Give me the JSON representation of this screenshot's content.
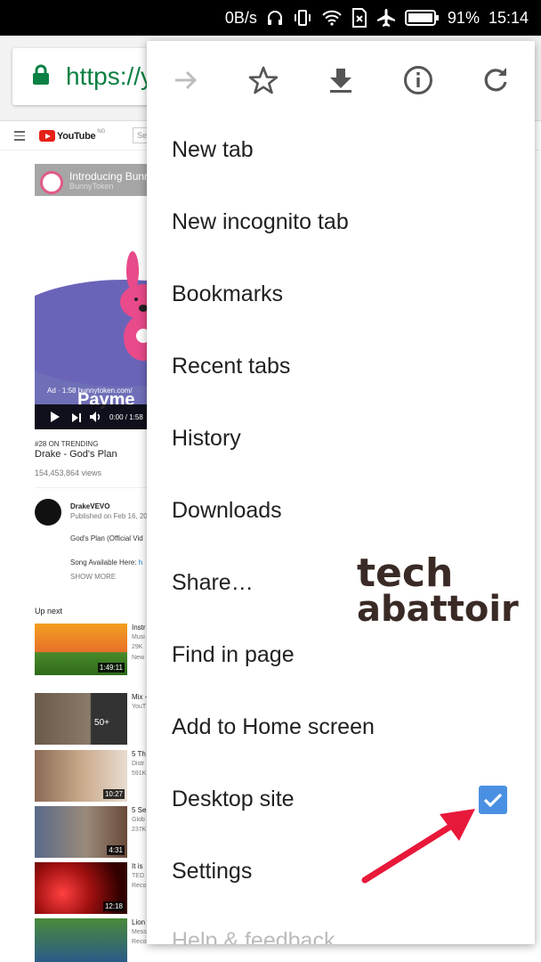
{
  "status_bar": {
    "net_speed": "0B/s",
    "battery_percent": "91%",
    "time": "15:14",
    "icons": [
      "headphones-icon",
      "vibrate-icon",
      "wifi-icon",
      "no-sim-icon",
      "airplane-icon",
      "battery-icon"
    ]
  },
  "omnibox": {
    "url": "https://y"
  },
  "page": {
    "header": {
      "logo": "YouTube",
      "region": "NG",
      "search_placeholder": "Se"
    },
    "player": {
      "title": "Introducing Bunny",
      "channel": "BunnyToken",
      "ad_line": "Ad · 1:58  bunnytoken.com/",
      "overlay_text": "Payme",
      "time": "0:00 / 1:58"
    },
    "trending": "#28 ON TRENDING",
    "video_title": "Drake - God's Plan",
    "views": "154,453,864 views",
    "channel": {
      "name": "DrakeVEVO",
      "published": "Published on Feb 16, 20",
      "desc_line1": "God's Plan (Official Vid",
      "desc_line2_prefix": "Song Available Here: ",
      "desc_line2_link": "h",
      "show_more": "SHOW MORE"
    },
    "up_next_label": "Up next",
    "up_next": [
      {
        "title": "Instr",
        "sub1": "Musi",
        "sub2": "29K",
        "sub3": "New",
        "duration": "1:49:11"
      },
      {
        "title": "Mix -",
        "sub1": "YouT",
        "sub2": "",
        "sub3": "",
        "duration": "50+"
      },
      {
        "title": "5 Th",
        "sub1": "Distr",
        "sub2": "591K",
        "sub3": "",
        "duration": "10:27"
      },
      {
        "title": "5 Se",
        "sub1": "Glob",
        "sub2": "237K",
        "sub3": "",
        "duration": "4:31"
      },
      {
        "title": "It is",
        "sub1": "TED",
        "sub2": "Reco",
        "sub3": "",
        "duration": "12:18"
      },
      {
        "title": "Lion",
        "sub1": "Mess",
        "sub2": "Recommended for you",
        "sub3": "",
        "duration": ""
      }
    ]
  },
  "menu": {
    "top_icons": [
      "forward-icon",
      "star-icon",
      "download-icon",
      "info-icon",
      "reload-icon"
    ],
    "items": [
      "New tab",
      "New incognito tab",
      "Bookmarks",
      "Recent tabs",
      "History",
      "Downloads",
      "Share…",
      "Find in page",
      "Add to Home screen",
      "Desktop site",
      "Settings",
      "Help & feedback"
    ],
    "desktop_site_checked": true
  },
  "watermark": {
    "line1": "tech",
    "line2": "abattoir"
  },
  "colors": {
    "accent": "#4a90e2",
    "url_green": "#0b8043",
    "annotation_arrow": "#e8183a"
  }
}
